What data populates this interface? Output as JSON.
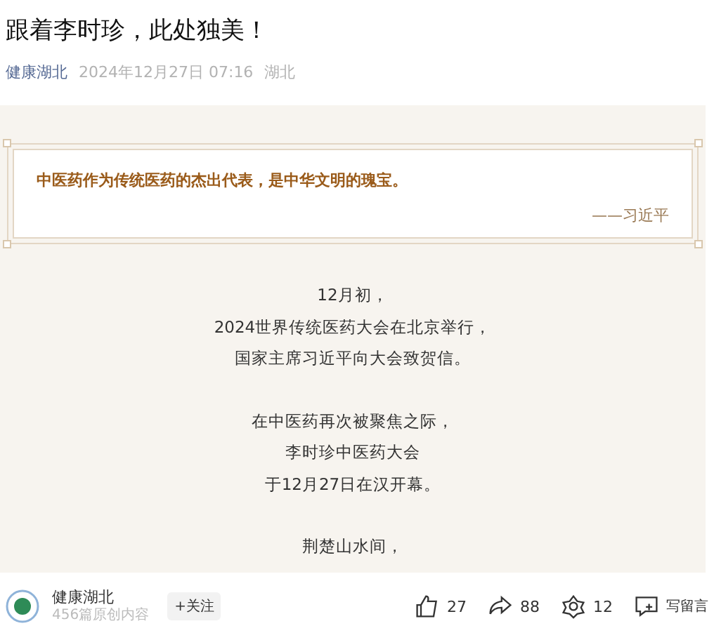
{
  "article": {
    "title": "跟着李时珍，此处独美！",
    "author": "健康湖北",
    "date": "2024年12月27日 07:16",
    "location": "湖北"
  },
  "quote": {
    "text": "中医药作为传统医药的杰出代表，是中华文明的瑰宝。",
    "attribution": "——习近平"
  },
  "paragraphs": [
    [
      "12月初，",
      "2024世界传统医药大会在北京举行，",
      "国家主席习近平向大会致贺信。"
    ],
    [
      "在中医药再次被聚焦之际，",
      "李时珍中医药大会",
      "于12月27日在汉开幕。"
    ],
    [
      "荆楚山水间，"
    ]
  ],
  "footer": {
    "account": "健康湖北",
    "subtitle": "456篇原创内容",
    "follow": "+关注",
    "likes": "27",
    "shares": "88",
    "wow": "12",
    "comment": "写留言"
  }
}
